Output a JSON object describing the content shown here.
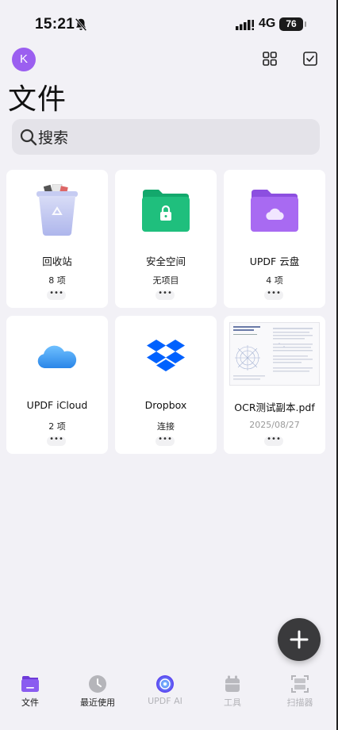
{
  "status_bar": {
    "time": "15:21",
    "network": "4G",
    "battery": "76"
  },
  "header": {
    "avatar_letter": "K",
    "title": "文件"
  },
  "search": {
    "placeholder": "搜索"
  },
  "cards": [
    {
      "name": "回收站",
      "meta": "8 项",
      "icon": "trash-bin-icon"
    },
    {
      "name": "安全空间",
      "meta": "无项目",
      "icon": "secure-folder-icon"
    },
    {
      "name": "UPDF 云盘",
      "meta": "4 项",
      "icon": "cloud-folder-icon"
    },
    {
      "name": "UPDF iCloud",
      "meta": "2 项",
      "icon": "icloud-icon"
    },
    {
      "name": "Dropbox",
      "meta": "连接",
      "icon": "dropbox-icon"
    },
    {
      "name": "OCR测试副本.pdf",
      "meta": "2025/08/27",
      "icon": "pdf-thumbnail"
    }
  ],
  "more_label": "•••",
  "fab": {
    "icon": "plus-icon"
  },
  "tabs": [
    {
      "label": "文件",
      "icon": "files-icon",
      "state": "active"
    },
    {
      "label": "最近使用",
      "icon": "clock-icon",
      "state": "normal"
    },
    {
      "label": "UPDF AI",
      "icon": "ai-icon",
      "state": "normal"
    },
    {
      "label": "工具",
      "icon": "toolbox-icon",
      "state": "normal"
    },
    {
      "label": "扫描器",
      "icon": "scanner-icon",
      "state": "normal"
    }
  ],
  "colors": {
    "background": "#f2f1f6",
    "accent": "#9b5ff0",
    "secure_green": "#1fbf7d",
    "cloud_purple": "#a86af2",
    "dropbox_blue": "#0061fe"
  }
}
